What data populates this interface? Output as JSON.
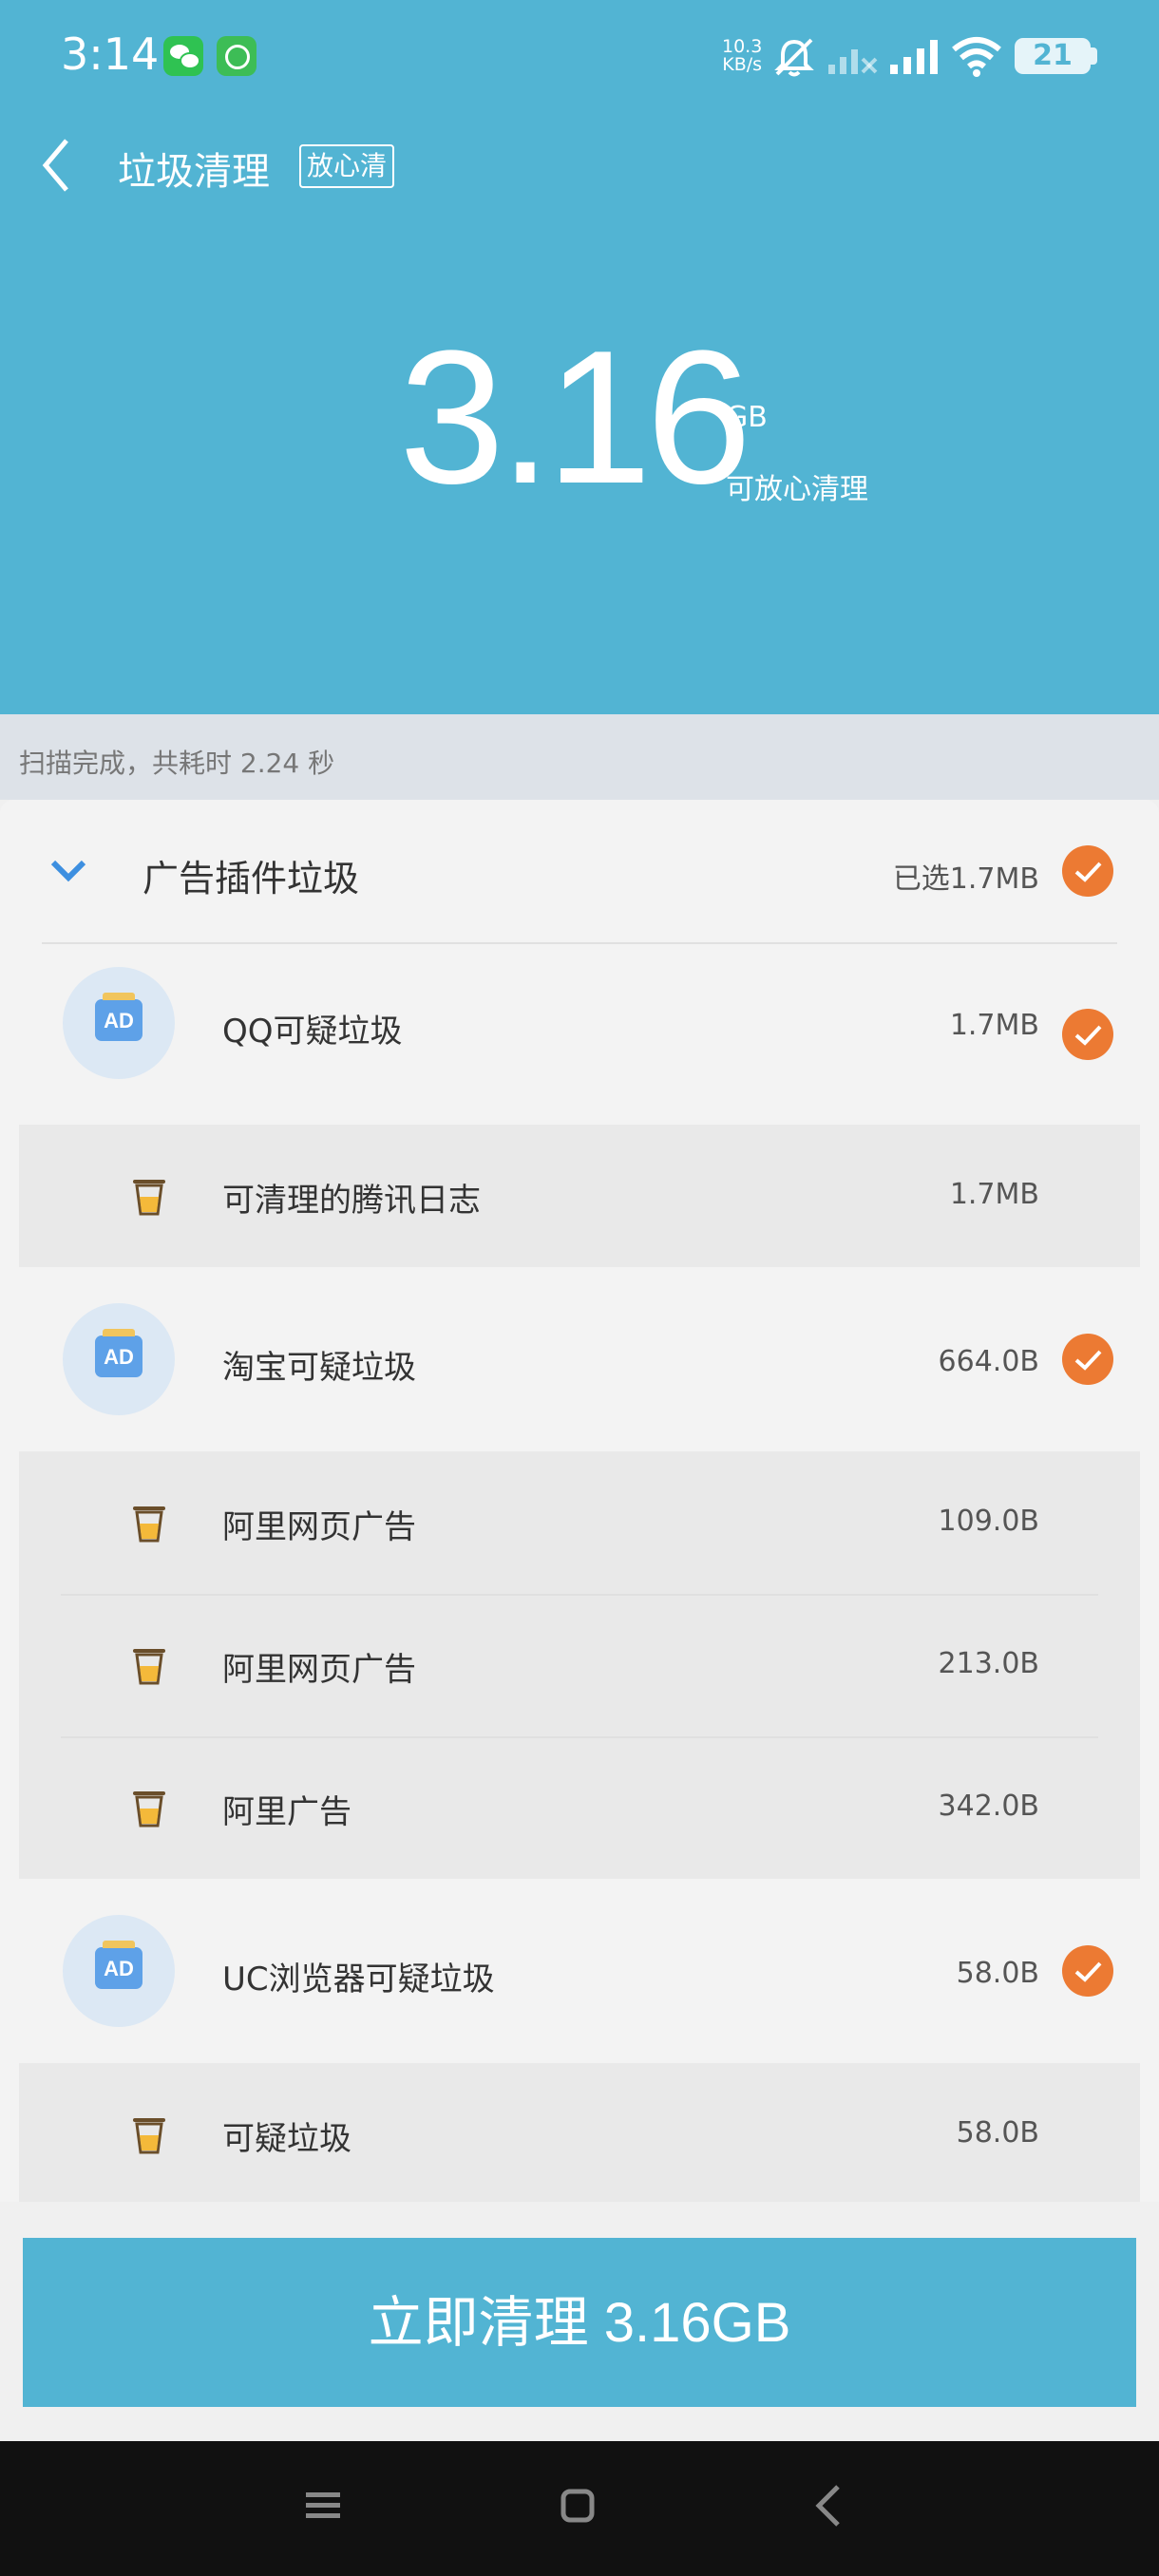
{
  "status_bar": {
    "time": "3:14",
    "net_speed_value": "10.3",
    "net_speed_unit": "KB/s",
    "battery": "21",
    "icons": [
      "wechat-icon",
      "app-icon",
      "bell-muted-icon",
      "signal-icon",
      "signal-icon",
      "wifi-icon",
      "battery-icon"
    ]
  },
  "header": {
    "title": "垃圾清理",
    "badge": "放心清"
  },
  "summary": {
    "amount": "3.16",
    "unit": "GB",
    "subtitle": "可放心清理"
  },
  "scan_status": "扫描完成，共耗时 2.24 秒",
  "category": {
    "title": "广告插件垃圾",
    "selected": "已选1.7MB"
  },
  "groups": [
    {
      "name": "QQ可疑垃圾",
      "size": "1.7MB",
      "items": [
        {
          "name": "可清理的腾讯日志",
          "size": "1.7MB"
        }
      ]
    },
    {
      "name": "淘宝可疑垃圾",
      "size": "664.0B",
      "items": [
        {
          "name": "阿里网页广告",
          "size": "109.0B"
        },
        {
          "name": "阿里网页广告",
          "size": "213.0B"
        },
        {
          "name": "阿里广告",
          "size": "342.0B"
        }
      ]
    },
    {
      "name": "UC浏览器可疑垃圾",
      "size": "58.0B",
      "items": [
        {
          "name": "可疑垃圾",
          "size": "58.0B"
        }
      ]
    }
  ],
  "ad_icon_text": "AD",
  "clean_button": "立即清理 3.16GB",
  "colors": {
    "accent": "#52b4d3",
    "check": "#ec7a33",
    "ad_icon": "#5ea1e8"
  }
}
